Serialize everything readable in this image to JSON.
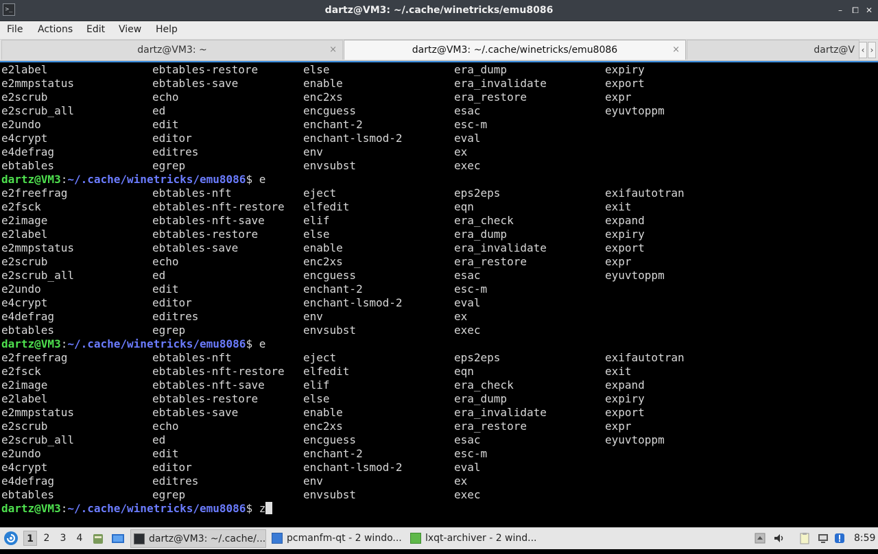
{
  "window": {
    "title": "dartz@VM3: ~/.cache/winetricks/emu8086",
    "app_icon": "terminal-icon",
    "controls": {
      "minimize": "–",
      "maximize": "⧠",
      "close": "✕"
    }
  },
  "menu": [
    "File",
    "Actions",
    "Edit",
    "View",
    "Help"
  ],
  "tabs": [
    {
      "label": "dartz@VM3: ~",
      "close": "×"
    },
    {
      "label": "dartz@VM3: ~/.cache/winetricks/emu8086",
      "close": "×"
    },
    {
      "label": "dartz@V"
    }
  ],
  "tab_scroll": {
    "left": "‹",
    "right": "›"
  },
  "terminal": {
    "prompt_user": "dartz@VM3",
    "prompt_sep": ":",
    "prompt_path": "~/.cache/winetricks/emu8086",
    "prompt_symbol": "$ ",
    "lines": [
      {
        "cols": [
          "e2label",
          "ebtables-restore",
          "else",
          "era_dump",
          "expiry"
        ]
      },
      {
        "cols": [
          "e2mmpstatus",
          "ebtables-save",
          "enable",
          "era_invalidate",
          "export"
        ]
      },
      {
        "cols": [
          "e2scrub",
          "echo",
          "enc2xs",
          "era_restore",
          "expr"
        ]
      },
      {
        "cols": [
          "e2scrub_all",
          "ed",
          "encguess",
          "esac",
          "eyuvtoppm"
        ]
      },
      {
        "cols": [
          "e2undo",
          "edit",
          "enchant-2",
          "esc-m",
          ""
        ]
      },
      {
        "cols": [
          "e4crypt",
          "editor",
          "enchant-lsmod-2",
          "eval",
          ""
        ]
      },
      {
        "cols": [
          "e4defrag",
          "editres",
          "env",
          "ex",
          ""
        ]
      },
      {
        "cols": [
          "ebtables",
          "egrep",
          "envsubst",
          "exec",
          ""
        ]
      },
      {
        "prompt": true,
        "cmd": "e"
      },
      {
        "cols": [
          "e2freefrag",
          "ebtables-nft",
          "eject",
          "eps2eps",
          "exifautotran"
        ]
      },
      {
        "cols": [
          "e2fsck",
          "ebtables-nft-restore",
          "elfedit",
          "eqn",
          "exit"
        ]
      },
      {
        "cols": [
          "e2image",
          "ebtables-nft-save",
          "elif",
          "era_check",
          "expand"
        ]
      },
      {
        "cols": [
          "e2label",
          "ebtables-restore",
          "else",
          "era_dump",
          "expiry"
        ]
      },
      {
        "cols": [
          "e2mmpstatus",
          "ebtables-save",
          "enable",
          "era_invalidate",
          "export"
        ]
      },
      {
        "cols": [
          "e2scrub",
          "echo",
          "enc2xs",
          "era_restore",
          "expr"
        ]
      },
      {
        "cols": [
          "e2scrub_all",
          "ed",
          "encguess",
          "esac",
          "eyuvtoppm"
        ]
      },
      {
        "cols": [
          "e2undo",
          "edit",
          "enchant-2",
          "esc-m",
          ""
        ]
      },
      {
        "cols": [
          "e4crypt",
          "editor",
          "enchant-lsmod-2",
          "eval",
          ""
        ]
      },
      {
        "cols": [
          "e4defrag",
          "editres",
          "env",
          "ex",
          ""
        ]
      },
      {
        "cols": [
          "ebtables",
          "egrep",
          "envsubst",
          "exec",
          ""
        ]
      },
      {
        "prompt": true,
        "cmd": "e"
      },
      {
        "cols": [
          "e2freefrag",
          "ebtables-nft",
          "eject",
          "eps2eps",
          "exifautotran"
        ]
      },
      {
        "cols": [
          "e2fsck",
          "ebtables-nft-restore",
          "elfedit",
          "eqn",
          "exit"
        ]
      },
      {
        "cols": [
          "e2image",
          "ebtables-nft-save",
          "elif",
          "era_check",
          "expand"
        ]
      },
      {
        "cols": [
          "e2label",
          "ebtables-restore",
          "else",
          "era_dump",
          "expiry"
        ]
      },
      {
        "cols": [
          "e2mmpstatus",
          "ebtables-save",
          "enable",
          "era_invalidate",
          "export"
        ]
      },
      {
        "cols": [
          "e2scrub",
          "echo",
          "enc2xs",
          "era_restore",
          "expr"
        ]
      },
      {
        "cols": [
          "e2scrub_all",
          "ed",
          "encguess",
          "esac",
          "eyuvtoppm"
        ]
      },
      {
        "cols": [
          "e2undo",
          "edit",
          "enchant-2",
          "esc-m",
          ""
        ]
      },
      {
        "cols": [
          "e4crypt",
          "editor",
          "enchant-lsmod-2",
          "eval",
          ""
        ]
      },
      {
        "cols": [
          "e4defrag",
          "editres",
          "env",
          "ex",
          ""
        ]
      },
      {
        "cols": [
          "ebtables",
          "egrep",
          "envsubst",
          "exec",
          ""
        ]
      },
      {
        "prompt": true,
        "cmd": "z",
        "cursor": true
      }
    ]
  },
  "taskbar": {
    "workspaces": [
      "1",
      "2",
      "3",
      "4"
    ],
    "active_workspace": "1",
    "tasks": [
      {
        "label": "dartz@VM3: ~/.cache/...",
        "icon": "terminal-icon",
        "active": true
      },
      {
        "label": "pcmanfm-qt - 2 windo...",
        "icon": "folder-icon",
        "active": false
      },
      {
        "label": "lxqt-archiver - 2 wind...",
        "icon": "archive-icon",
        "active": false
      }
    ],
    "clock": "8:59",
    "colors": {
      "terminal_prompt_user": "#4ee04e",
      "terminal_prompt_path": "#6b7cff",
      "focus_accent": "#3a8de0"
    }
  }
}
